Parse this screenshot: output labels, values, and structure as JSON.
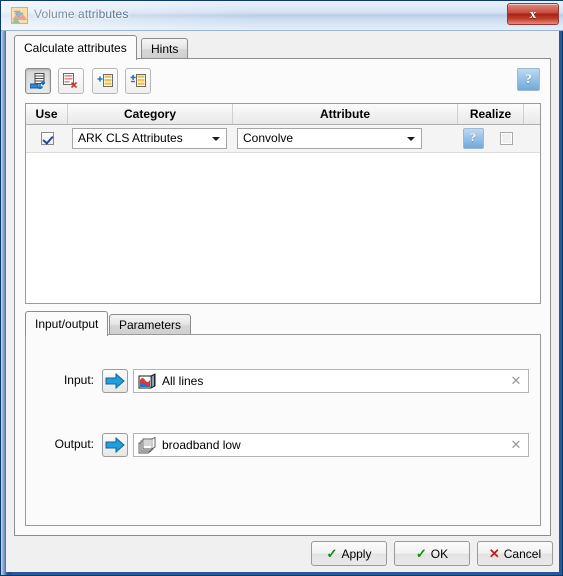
{
  "window": {
    "title": "Volume attributes",
    "icon": "volume-attributes-icon",
    "close_label": "x"
  },
  "tabs": {
    "items": [
      {
        "label": "Calculate attributes",
        "active": true
      },
      {
        "label": "Hints",
        "active": false
      }
    ]
  },
  "toolbar": {
    "buttons": [
      {
        "name": "add-attribute-button",
        "icon": "add-row-icon",
        "pressed": true
      },
      {
        "name": "remove-attribute-button",
        "icon": "remove-row-icon",
        "pressed": false
      },
      {
        "name": "move-up-button",
        "icon": "move-up-icon",
        "pressed": false
      },
      {
        "name": "move-down-button",
        "icon": "move-down-icon",
        "pressed": false
      }
    ],
    "help_label": "?"
  },
  "attribute_table": {
    "columns": [
      "Use",
      "Category",
      "Attribute",
      "Realize"
    ],
    "rows": [
      {
        "use_checked": true,
        "category": "ARK CLS Attributes",
        "attribute": "Convolve",
        "row_help_label": "?",
        "realize_checked": false
      }
    ]
  },
  "inner_tabs": {
    "items": [
      {
        "label": "Input/output",
        "active": true
      },
      {
        "label": "Parameters",
        "active": false
      }
    ]
  },
  "io": {
    "input": {
      "label": "Input:",
      "select_icon": "blue-arrow-icon",
      "item_icon": "seismic-volume-icon",
      "value": "All lines",
      "clear_label": "✕"
    },
    "output": {
      "label": "Output:",
      "select_icon": "blue-arrow-icon",
      "item_icon": "volume-stack-icon",
      "value": "broadband low",
      "clear_label": "✕"
    }
  },
  "buttons": {
    "apply": {
      "label": "Apply",
      "glyph": "✓"
    },
    "ok": {
      "label": "OK",
      "glyph": "✓"
    },
    "cancel": {
      "label": "Cancel",
      "glyph": "✕"
    }
  },
  "colors": {
    "frame_blue": "#1d4a8e",
    "accent_blue": "#6fa9dd",
    "ok_green": "#148a14",
    "cancel_red": "#bb2222",
    "close_red": "#a32517"
  }
}
